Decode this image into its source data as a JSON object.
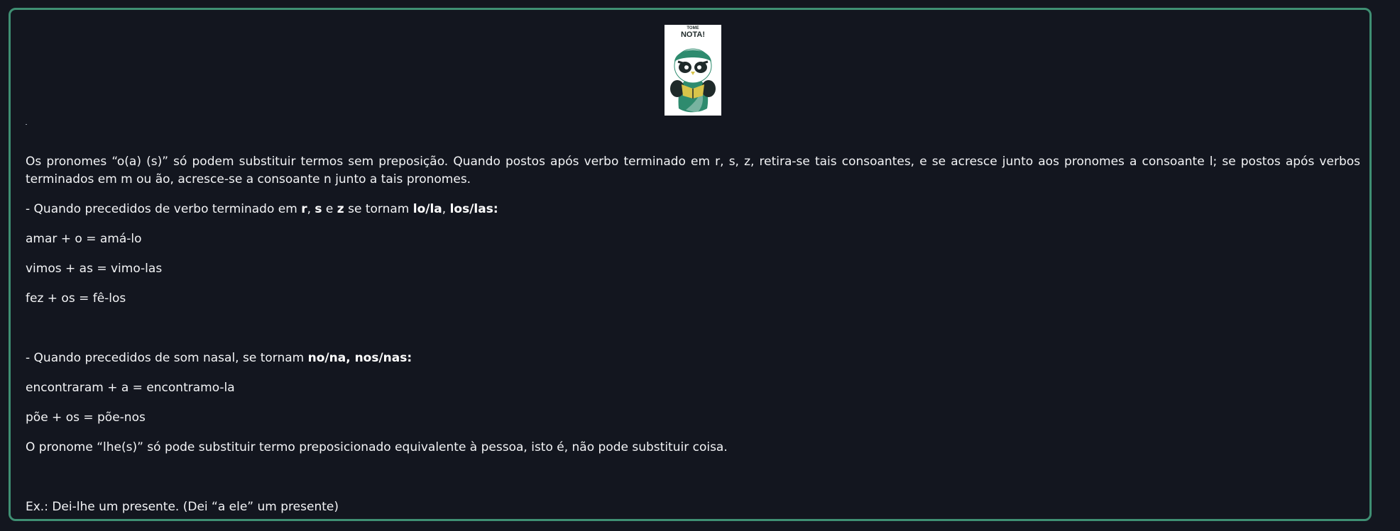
{
  "logo": {
    "top_text": "TOME",
    "main_text": "NOTA!",
    "colors": {
      "green": "#2e8b6e",
      "dark": "#1f2a2a",
      "yellow": "#d8c44a",
      "white": "#ffffff"
    }
  },
  "intro": "Os pronomes “o(a) (s)” só podem substituir termos sem preposição. Quando postos após verbo terminado em r, s, z, retira-se tais consoantes, e se acresce junto aos pronomes a consoante l; se postos após verbos terminados em m ou ão, acresce-se a consoante n junto a tais pronomes.",
  "rule1": {
    "prefix": "- Quando precedidos de verbo terminado em ",
    "r": "r",
    "sep1": ", ",
    "s": "s",
    "sep2": " e ",
    "z": "z",
    "middle": " se tornam ",
    "lola": "lo/la",
    "sep3": ", ",
    "loslas": "los/las:"
  },
  "examples1": [
    "amar + o = amá-lo",
    "vimos + as = vimo-las",
    "fez + os = fê-los"
  ],
  "rule2": {
    "prefix": "- Quando precedidos de som nasal, se tornam ",
    "bold": "no/na, nos/nas:"
  },
  "examples2": [
    "encontraram + a = encontramo-la",
    "põe + os = põe-nos"
  ],
  "lhe_rule": "O pronome “lhe(s)” só pode substituir termo preposicionado equivalente à pessoa, isto é, não pode substituir coisa.",
  "example_final": "Ex.: Dei-lhe um presente. (Dei “a ele” um presente)"
}
